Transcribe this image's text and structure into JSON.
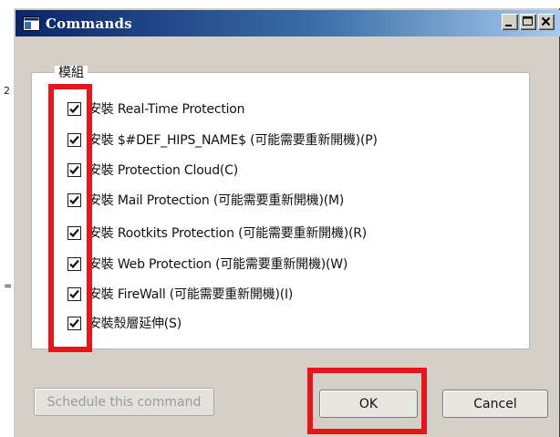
{
  "window": {
    "title": "Commands",
    "controls": [
      "minimize",
      "maximize",
      "close"
    ]
  },
  "stray_marks": {
    "top": "2",
    "mid": "="
  },
  "group": {
    "label": "模組",
    "items": [
      {
        "label": "安裝 Real-Time Protection",
        "checked": true
      },
      {
        "label": "安裝 $#DEF_HIPS_NAME$ (可能需要重新開機)(P)",
        "checked": true
      },
      {
        "label": "安裝 Protection Cloud(C)",
        "checked": true
      },
      {
        "label": "安裝 Mail Protection (可能需要重新開機)(M)",
        "checked": true
      },
      {
        "label": "安裝 Rootkits Protection (可能需要重新開機)(R)",
        "checked": true
      },
      {
        "label": "安裝 Web Protection (可能需要重新開機)(W)",
        "checked": true
      },
      {
        "label": "安裝 FireWall (可能需要重新開機)(I)",
        "checked": true
      },
      {
        "label": "安裝殼層延伸(S)",
        "checked": true
      }
    ]
  },
  "buttons": {
    "schedule": "Schedule this command",
    "ok": "OK",
    "cancel": "Cancel"
  },
  "colors": {
    "highlight": "#e8161c",
    "title_start": "#0a246a",
    "title_end": "#a6caf0",
    "dialog_bg": "#d4d0c8"
  }
}
